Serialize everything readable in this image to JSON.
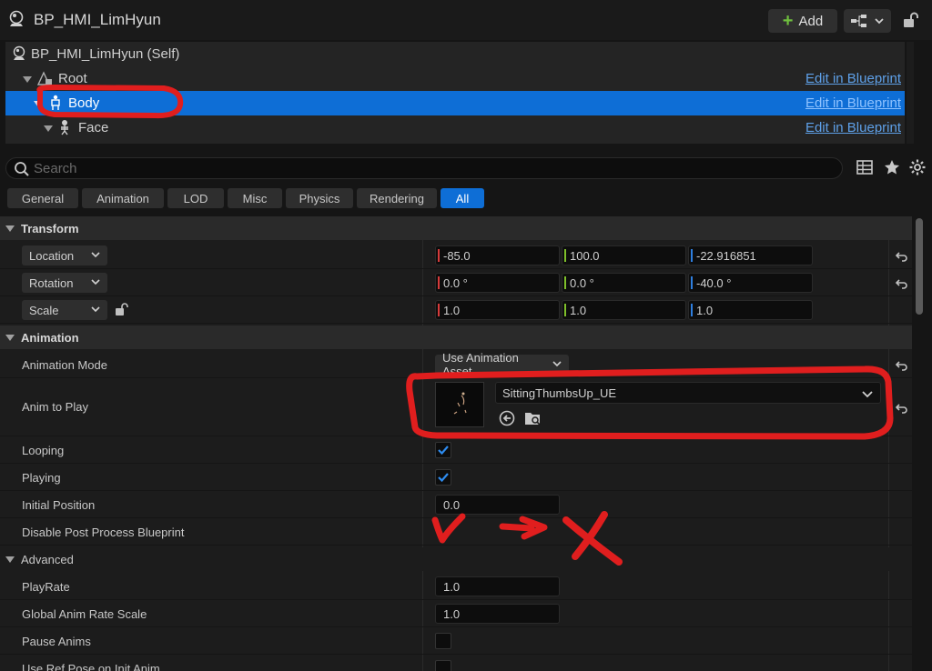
{
  "header": {
    "title": "BP_HMI_LimHyun",
    "add_label": "Add"
  },
  "tree": {
    "items": [
      {
        "label": "BP_HMI_LimHyun (Self)",
        "edit": ""
      },
      {
        "label": "Root",
        "edit": "Edit in Blueprint"
      },
      {
        "label": "Body",
        "edit": "Edit in Blueprint"
      },
      {
        "label": "Face",
        "edit": "Edit in Blueprint"
      }
    ]
  },
  "search": {
    "placeholder": "Search"
  },
  "tabs": [
    "General",
    "Animation",
    "LOD",
    "Misc",
    "Physics",
    "Rendering",
    "All"
  ],
  "transform": {
    "title": "Transform",
    "location": {
      "label": "Location",
      "x": "-85.0",
      "y": "100.0",
      "z": "-22.916851"
    },
    "rotation": {
      "label": "Rotation",
      "x": "0.0 °",
      "y": "0.0 °",
      "z": "-40.0 °"
    },
    "scale": {
      "label": "Scale",
      "x": "1.0",
      "y": "1.0",
      "z": "1.0"
    }
  },
  "animation": {
    "title": "Animation",
    "mode_label": "Animation Mode",
    "mode_value": "Use Animation Asset",
    "anim_label": "Anim to Play",
    "anim_value": "SittingThumbsUp_UE",
    "looping_label": "Looping",
    "looping": true,
    "playing_label": "Playing",
    "playing": true,
    "initpos_label": "Initial Position",
    "initpos_value": "0.0",
    "disablepp_label": "Disable Post Process Blueprint"
  },
  "advanced": {
    "title": "Advanced",
    "playrate_label": "PlayRate",
    "playrate_value": "1.0",
    "global_label": "Global Anim Rate Scale",
    "global_value": "1.0",
    "pause_label": "Pause Anims",
    "refpose_label": "Use Ref Pose on Init Anim"
  },
  "colors": {
    "accent": "#0e6ed6",
    "x_axis": "#d63a3a",
    "y_axis": "#7fbf2a",
    "z_axis": "#2e7fe0",
    "annotation": "#e01e1e"
  }
}
